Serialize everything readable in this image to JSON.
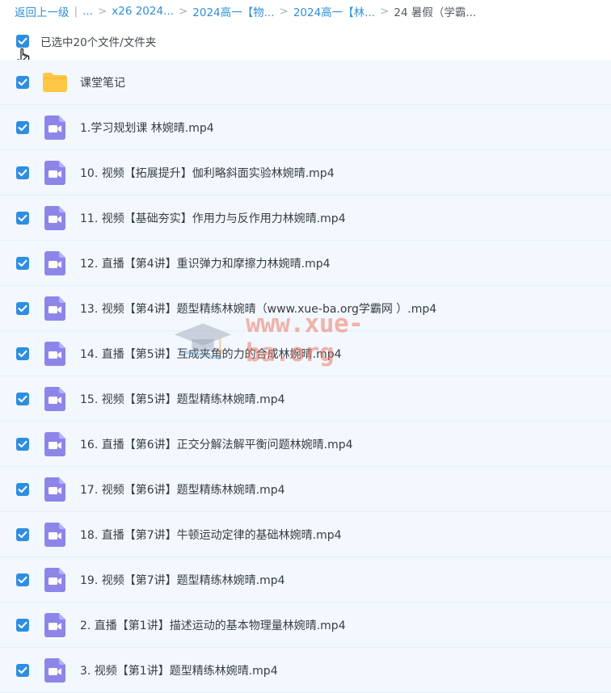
{
  "breadcrumb": {
    "back": "返回上一级",
    "divider": "|",
    "ellipsis": "...",
    "sep": ">",
    "items": [
      "x26 2024...",
      "2024高一【物...",
      "2024高一【林..."
    ],
    "current": "24 暑假（学霸..."
  },
  "selection": {
    "label": "已选中20个文件/文件夹"
  },
  "files": [
    {
      "name": "课堂笔记",
      "icon": "folder-icon"
    },
    {
      "name": "1.学习规划课 林婉晴.mp4",
      "icon": "video-file-icon"
    },
    {
      "name": "10. 视频【拓展提升】伽利略斜面实验林婉晴.mp4",
      "icon": "video-file-icon"
    },
    {
      "name": "11. 视频【基础夯实】作用力与反作用力林婉晴.mp4",
      "icon": "video-file-icon"
    },
    {
      "name": "12. 直播【第4讲】重识弹力和摩擦力林婉晴.mp4",
      "icon": "video-file-icon"
    },
    {
      "name": "13. 视频【第4讲】题型精练林婉晴（www.xue-ba.org学霸网 ）.mp4",
      "icon": "video-file-icon"
    },
    {
      "name": "14. 直播【第5讲】互成夹角的力的合成林婉晴.mp4",
      "icon": "video-file-icon"
    },
    {
      "name": "15. 视频【第5讲】题型精练林婉晴.mp4",
      "icon": "video-file-icon"
    },
    {
      "name": "16. 直播【第6讲】正交分解法解平衡问题林婉晴.mp4",
      "icon": "video-file-icon"
    },
    {
      "name": "17. 视频【第6讲】题型精练林婉晴.mp4",
      "icon": "video-file-icon"
    },
    {
      "name": "18. 直播【第7讲】牛顿运动定律的基础林婉晴.mp4",
      "icon": "video-file-icon"
    },
    {
      "name": "19. 视频【第7讲】题型精练林婉晴.mp4",
      "icon": "video-file-icon"
    },
    {
      "name": "2. 直播【第1讲】描述运动的基本物理量林婉晴.mp4",
      "icon": "video-file-icon"
    },
    {
      "name": "3. 视频【第1讲】题型精练林婉晴.mp4",
      "icon": "video-file-icon"
    }
  ],
  "watermark": {
    "text": "www.xue-ba.org"
  },
  "colors": {
    "accent": "#2f8fd8",
    "checkbox": "#2f8ee0",
    "row_bg": "#f3f8fe",
    "video_icon": "#8e85e9",
    "folder_icon": "#fcc845"
  }
}
